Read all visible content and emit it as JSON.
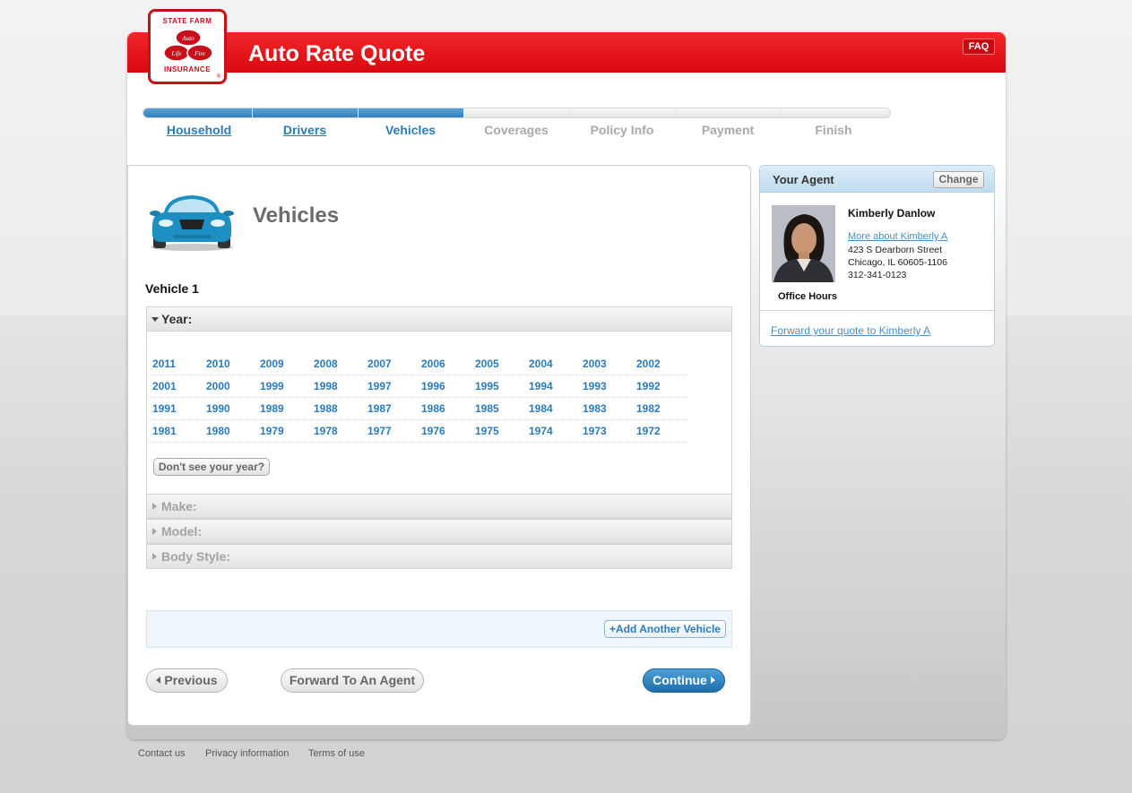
{
  "header": {
    "logo": {
      "top": "STATE FARM",
      "bottom": "INSURANCE",
      "rings": [
        "Auto",
        "Life",
        "Fire"
      ],
      "reg": "®"
    },
    "title": "Auto Rate Quote",
    "faq_label": "FAQ"
  },
  "progress": {
    "fraction": 0.429,
    "steps": [
      {
        "label": "Household",
        "state": "done"
      },
      {
        "label": "Drivers",
        "state": "done"
      },
      {
        "label": "Vehicles",
        "state": "current"
      },
      {
        "label": "Coverages",
        "state": "future"
      },
      {
        "label": "Policy Info",
        "state": "future"
      },
      {
        "label": "Payment",
        "state": "future"
      },
      {
        "label": "Finish",
        "state": "future"
      }
    ]
  },
  "main": {
    "icon": "car-icon",
    "heading": "Vehicles",
    "vehicle_label": "Vehicle 1",
    "year_section": {
      "label": "Year:",
      "rows": [
        [
          "2011",
          "2010",
          "2009",
          "2008",
          "2007",
          "2006",
          "2005",
          "2004",
          "2003",
          "2002"
        ],
        [
          "2001",
          "2000",
          "1999",
          "1998",
          "1997",
          "1996",
          "1995",
          "1994",
          "1993",
          "1992"
        ],
        [
          "1991",
          "1990",
          "1989",
          "1988",
          "1987",
          "1986",
          "1985",
          "1984",
          "1983",
          "1982"
        ],
        [
          "1981",
          "1980",
          "1979",
          "1978",
          "1977",
          "1976",
          "1975",
          "1974",
          "1973",
          "1972"
        ]
      ],
      "dont_see_label": "Don't see your year?"
    },
    "make_label": "Make:",
    "model_label": "Model:",
    "body_style_label": "Body Style:",
    "add_vehicle_label": "+Add Another Vehicle",
    "previous_label": "Previous",
    "forward_label": "Forward To An Agent",
    "continue_label": "Continue"
  },
  "agent": {
    "title": "Your Agent",
    "change_label": "Change",
    "name": "Kimberly Danlow",
    "more_link": "More about Kimberly A",
    "address1": "423 S Dearborn Street",
    "address2": "Chicago, IL 60605-1106",
    "phone": "312-341-0123",
    "office_hours_label": "Office Hours",
    "forward_link": "Forward your quote to Kimberly A"
  },
  "footer": {
    "contact": "Contact us",
    "privacy": "Privacy information",
    "terms": "Terms of use"
  },
  "colors": {
    "brand_red": "#e3131a",
    "link_blue": "#2b7bb9",
    "continue_blue": "#2a7bbd"
  }
}
